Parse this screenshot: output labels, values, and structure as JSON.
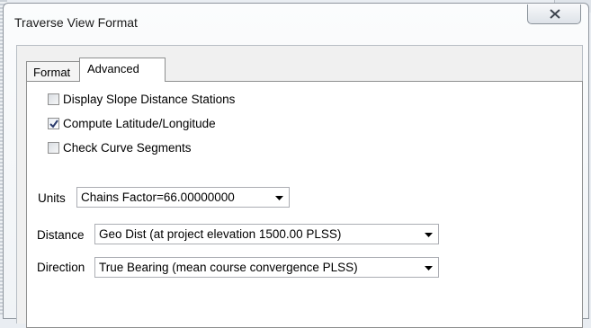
{
  "window": {
    "title": "Traverse View Format"
  },
  "tabs": [
    {
      "label": "Format",
      "active": false
    },
    {
      "label": "Advanced",
      "active": true
    }
  ],
  "advanced": {
    "checkboxes": [
      {
        "label": "Display Slope Distance Stations",
        "checked": false
      },
      {
        "label": "Compute Latitude/Longitude",
        "checked": true
      },
      {
        "label": "Check Curve Segments",
        "checked": false
      }
    ],
    "units": {
      "label": "Units",
      "value": "Chains  Factor=66.00000000"
    },
    "distance": {
      "label": "Distance",
      "value": "Geo Dist (at project elevation 1500.00 PLSS)"
    },
    "direction": {
      "label": "Direction",
      "value": "True Bearing (mean course convergence PLSS)"
    }
  },
  "icons": {
    "close": "close-x-icon",
    "dropdown": "dropdown-arrow-icon",
    "check": "checkmark-icon"
  },
  "colors": {
    "checkmark": "#2a3a6b",
    "window_border": "#8f969e"
  }
}
